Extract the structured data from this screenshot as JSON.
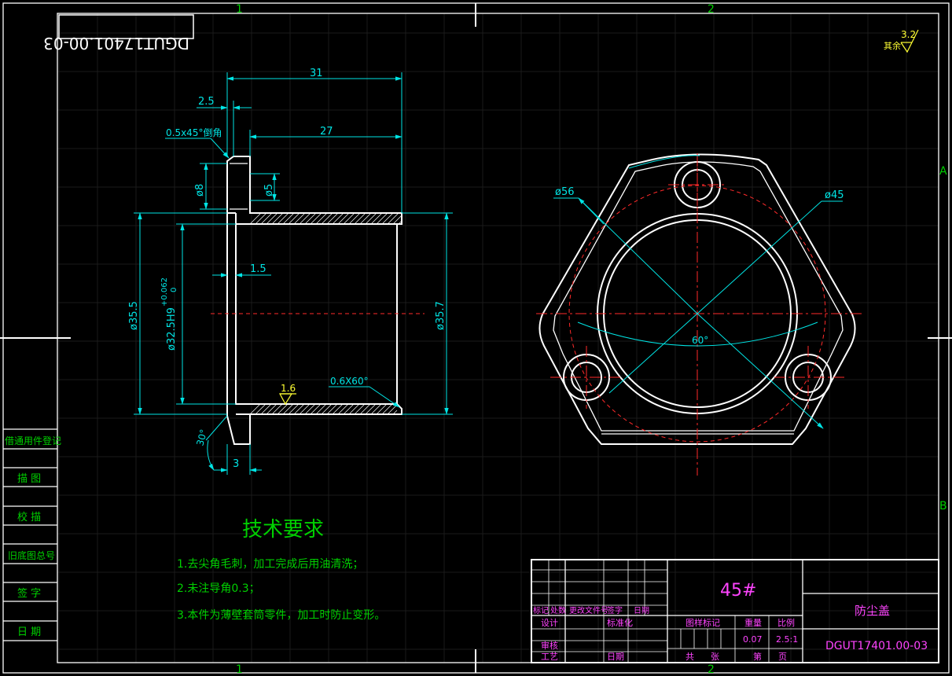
{
  "frame": {
    "zone_top_1": "1",
    "zone_top_2": "2",
    "zone_bottom_1": "1",
    "zone_bottom_2": "2",
    "zone_right_a": "A",
    "zone_right_b": "B",
    "mirrored_code": "DGUT17401.00-03"
  },
  "roughness": {
    "label": "其余",
    "value": "3.2"
  },
  "side_view": {
    "dim_31": "31",
    "dim_27": "27",
    "dim_2_5": "2.5",
    "chamfer": "0.5x45°倒角",
    "dia_8": "ø8",
    "dia_5": "ø5",
    "dim_1_5": "1.5",
    "dia_35_5": "ø35.5",
    "dia_32_5": "ø32.5H9",
    "tolerance_upper": "+0.062",
    "tolerance_lower": "0",
    "dia_35_7": "ø35.7",
    "roughness_1_6": "1.6",
    "chamfer_06": "0.6X60°",
    "angle_30": "30°",
    "dim_3": "3"
  },
  "front_view": {
    "dia_56": "ø56",
    "dia_45": "ø45",
    "angle_60": "60°"
  },
  "requirements": {
    "title": "技术要求",
    "item1": "1.去尖角毛刺，加工完成后用油清洗；",
    "item2": "2.未注导角0.3；",
    "item3": "3.本件为薄壁套筒零件，加工时防止变形。"
  },
  "left_strip": [
    "借通用件登记",
    "描 图",
    "校 描",
    "旧底图总号",
    "签 字",
    "日 期"
  ],
  "title_block": {
    "material": "45#",
    "part_name": "防尘盖",
    "drawing_number": "DGUT17401.00-03",
    "rev_headers": [
      "标记",
      "处数",
      "更改文件号",
      "签字",
      "日期"
    ],
    "design": "设计",
    "standardization": "标准化",
    "review": "审核",
    "process": "工艺",
    "date": "日期",
    "stage_mark": "图样标记",
    "weight_label": "重量",
    "scale_label": "比例",
    "weight_value": "0.07",
    "scale_value": "2.5:1",
    "total_label": "共",
    "sheets_label": "张",
    "sheet_label": "第",
    "page_label": "页"
  }
}
